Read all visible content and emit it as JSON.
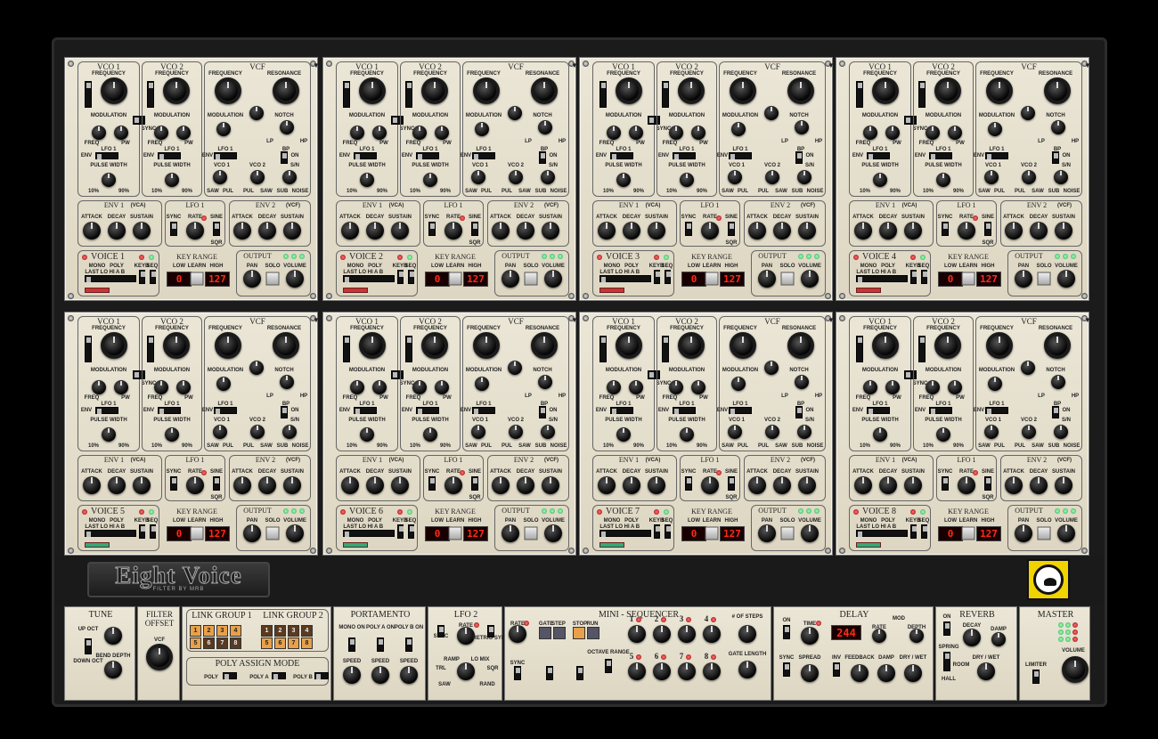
{
  "app": {
    "name": "Eight Voice",
    "subtitle": "FILTER BY MRB",
    "colors": {
      "panel": "#e6e0cf",
      "led_red": "#ff2a1a",
      "led_green": "#33aa66",
      "badge": "#f1d300"
    }
  },
  "module_labels": {
    "vco1": "VCO 1",
    "vco2": "VCO 2",
    "vcf": "VCF",
    "frequency": "FREQUENCY",
    "resonance": "RESONANCE",
    "modulation": "MODULATION",
    "sync": "SYNC",
    "on": "ON",
    "notch": "NOTCH",
    "freq": "FREQ",
    "pw": "PW",
    "lp": "LP",
    "hp": "HP",
    "bp": "BP",
    "lfo1": "LFO 1",
    "env": "ENV",
    "pulse_width": "PULSE WIDTH",
    "pct10": "10%",
    "pct90": "90%",
    "vco1_small": "VCO 1",
    "vco2_small": "VCO 2",
    "sn": "S/N",
    "saw": "SAW",
    "pul": "PUL",
    "sub": "SUB",
    "noise": "NOISE",
    "env1": "ENV 1",
    "env1_tag": "(VCA)",
    "env2": "ENV 2",
    "env2_tag": "(VCF)",
    "attack": "ATTACK",
    "decay": "DECAY",
    "sustain": "SUSTAIN",
    "rate": "RATE",
    "sine": "SINE",
    "sqr": "SQR",
    "key_range": "KEY RANGE",
    "low": "LOW",
    "learn": "LEARN",
    "high": "HIGH",
    "output": "OUTPUT",
    "pan": "PAN",
    "solo": "SOLO",
    "volume": "VOLUME",
    "keyb": "KEYB",
    "seq": "SEQ",
    "mono": "MONO",
    "poly": "POLY",
    "last_lo_hi": "LAST LO HI",
    "a_b": "A B",
    "menu_arrow": "▼"
  },
  "voices": [
    {
      "name": "VOICE 1",
      "low": "0",
      "high": "127"
    },
    {
      "name": "VOICE 2",
      "low": "0",
      "high": "127"
    },
    {
      "name": "VOICE 3",
      "low": "0",
      "high": "127"
    },
    {
      "name": "VOICE 4",
      "low": "0",
      "high": "127"
    },
    {
      "name": "VOICE 5",
      "low": "0",
      "high": "127"
    },
    {
      "name": "VOICE 6",
      "low": "0",
      "high": "127"
    },
    {
      "name": "VOICE 7",
      "low": "0",
      "high": "127"
    },
    {
      "name": "VOICE 8",
      "low": "0",
      "high": "127"
    }
  ],
  "global": {
    "tune": {
      "title": "TUNE",
      "up": "UP OCT",
      "down": "DOWN OCT",
      "bend": "BEND DEPTH"
    },
    "filter_offset": {
      "title": "FILTER OFFSET",
      "vcf": "VCF"
    },
    "link": {
      "group1": "LINK GROUP 1",
      "group2": "LINK GROUP 2",
      "g1_buttons": [
        "1",
        "2",
        "3",
        "4",
        "5",
        "6",
        "7",
        "8"
      ],
      "g2_buttons": [
        "1",
        "2",
        "3",
        "4",
        "5",
        "6",
        "7",
        "8"
      ],
      "poly_assign": "POLY ASSIGN MODE",
      "poly": "POLY",
      "poly_a": "POLY A",
      "poly_b": "POLY B"
    },
    "portamento": {
      "title": "PORTAMENTO",
      "mono": "MONO ON",
      "poly_a": "POLY A ON",
      "poly_b": "POLY B ON",
      "speed": "SPEED"
    },
    "lfo2": {
      "title": "LFO 2",
      "rate": "RATE",
      "sync": "SYNC",
      "retrig": "RETRIG SYNC",
      "ramp": "RAMP",
      "saw": "SAW",
      "sqr": "SQR",
      "trl": "TRL",
      "lo_mix": "LO MIX",
      "rand": "RAND"
    },
    "seq": {
      "title": "MINI - SEQUENCER",
      "rate": "RATE",
      "gate": "GATE",
      "step": "STEP",
      "stop": "STOP",
      "run": "RUN",
      "sync": "SYNC",
      "octave": "OCTAVE RANGE",
      "steps_label": "# OF STEPS",
      "gate_length": "GATE LENGTH",
      "step_numbers": [
        "1",
        "2",
        "3",
        "4",
        "5",
        "6",
        "7",
        "8"
      ]
    },
    "delay": {
      "title": "DELAY",
      "on": "ON",
      "time": "TIME",
      "display": "244",
      "rate": "RATE",
      "mod": "MOD",
      "depth": "DEPTH",
      "sync": "SYNC",
      "spread": "SPREAD",
      "inv": "INV",
      "feedback": "FEEDBACK",
      "damp": "DAMP",
      "dry_wet": "DRY / WET"
    },
    "reverb": {
      "title": "REVERB",
      "on": "ON",
      "decay": "DECAY",
      "damp": "DAMP",
      "spring": "SPRING",
      "room": "ROOM",
      "hall": "HALL",
      "dry_wet": "DRY / WET"
    },
    "master": {
      "title": "MASTER",
      "limiter": "LIMITER",
      "volume": "VOLUME"
    }
  }
}
